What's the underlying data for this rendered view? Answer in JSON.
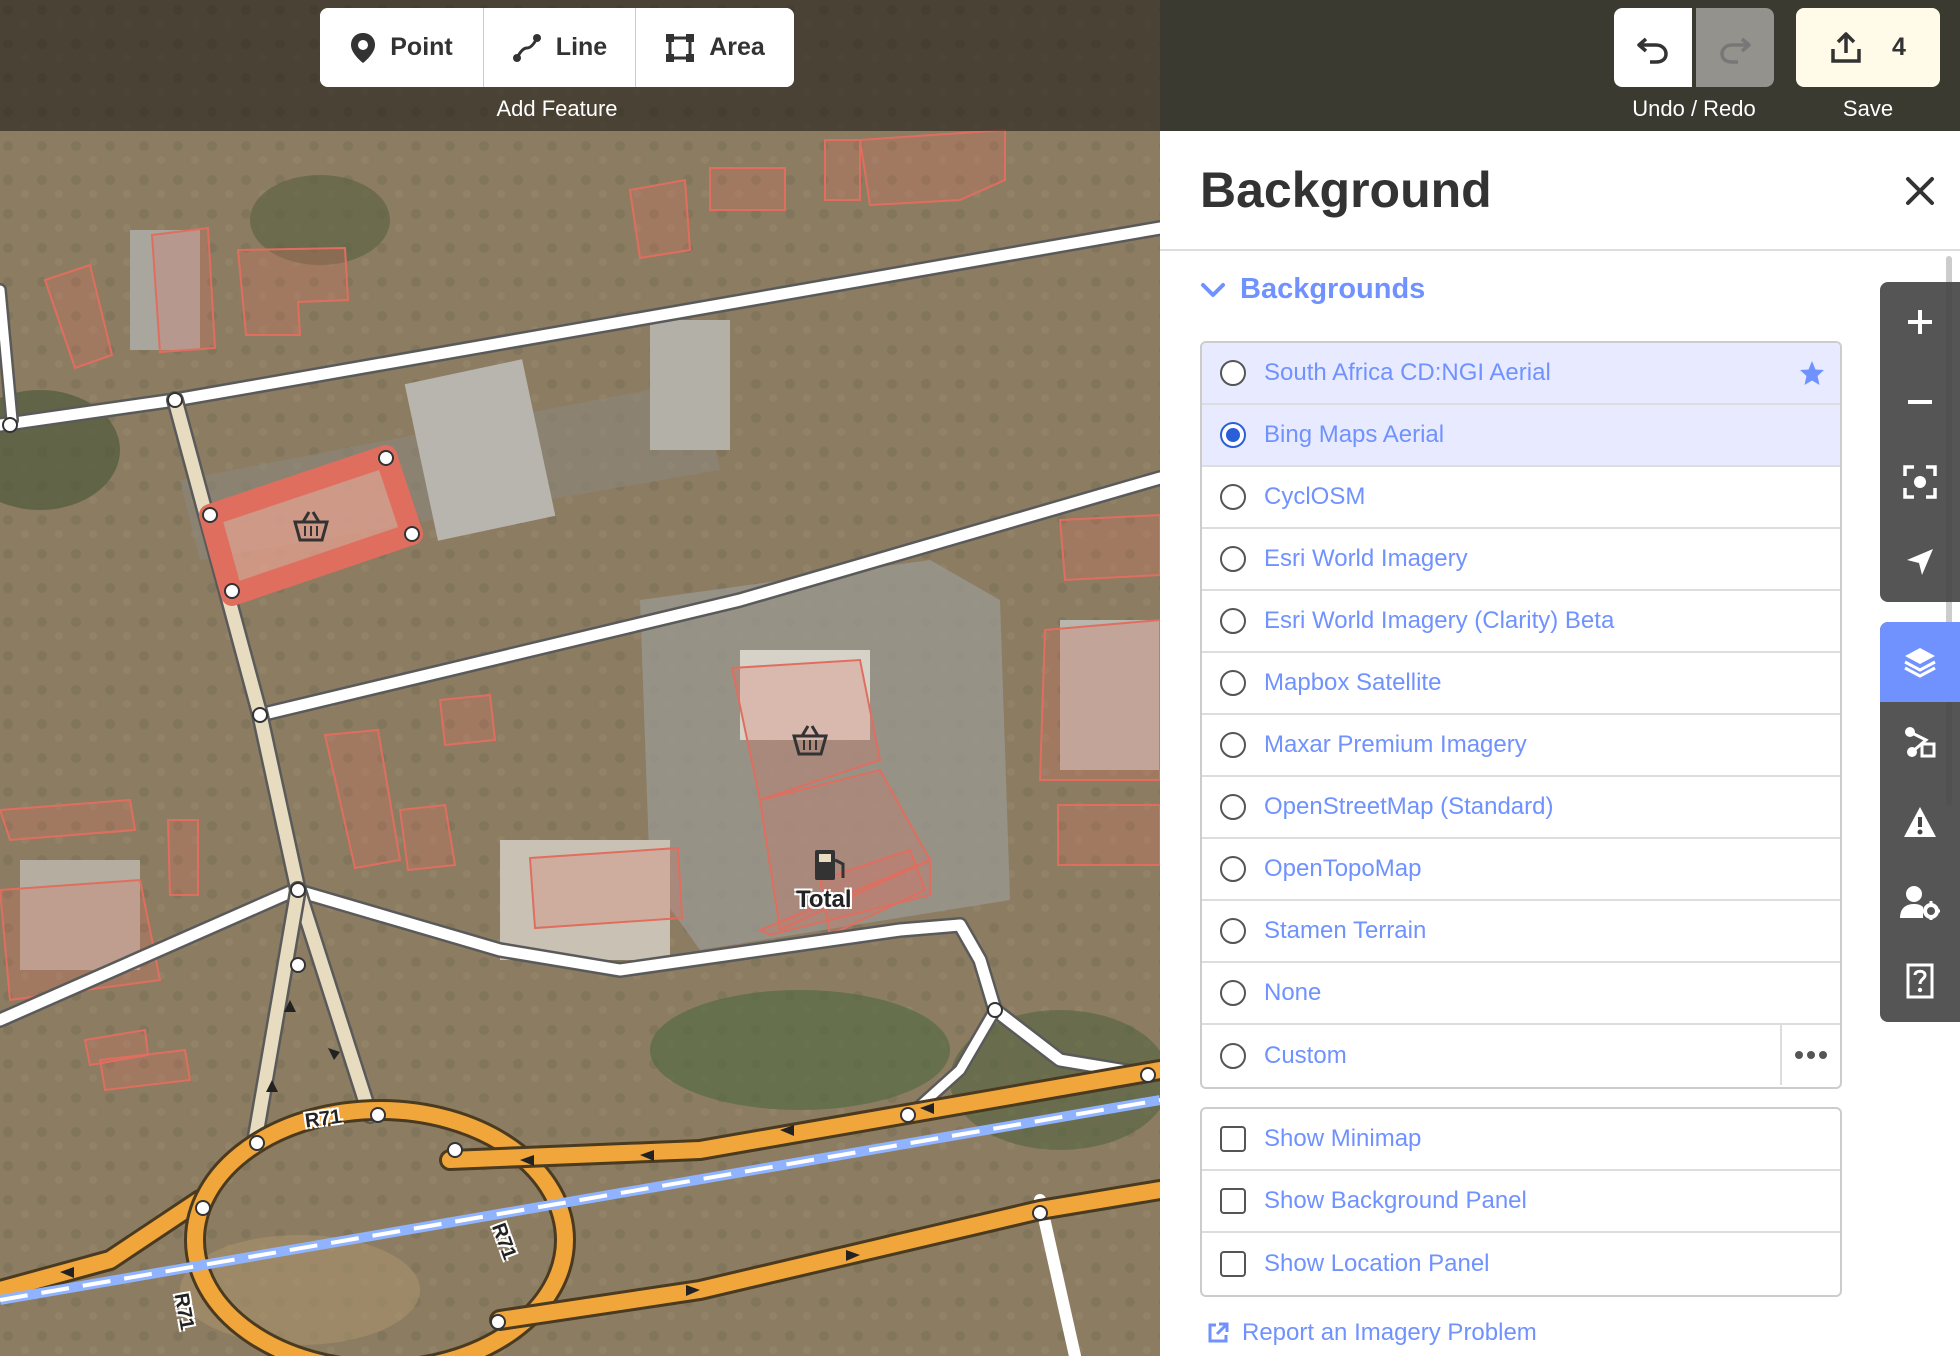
{
  "toolbar": {
    "add_feature": {
      "caption": "Add Feature",
      "buttons": [
        {
          "label": "Point",
          "icon": "marker-icon"
        },
        {
          "label": "Line",
          "icon": "line-icon"
        },
        {
          "label": "Area",
          "icon": "area-icon"
        }
      ]
    },
    "undo_redo": {
      "caption": "Undo / Redo"
    },
    "save": {
      "caption": "Save",
      "count": "4",
      "icon": "upload-icon"
    }
  },
  "map": {
    "poi_label": "Total",
    "road_labels": [
      "R71",
      "R71",
      "R71"
    ]
  },
  "panel": {
    "title": "Background",
    "section_title": "Backgrounds",
    "backgrounds": [
      {
        "label": "South Africa CD:NGI Aerial",
        "selected": false,
        "best": true
      },
      {
        "label": "Bing Maps Aerial",
        "selected": true
      },
      {
        "label": "CyclOSM",
        "selected": false
      },
      {
        "label": "Esri World Imagery",
        "selected": false
      },
      {
        "label": "Esri World Imagery (Clarity) Beta",
        "selected": false
      },
      {
        "label": "Mapbox Satellite",
        "selected": false
      },
      {
        "label": "Maxar Premium Imagery",
        "selected": false
      },
      {
        "label": "OpenStreetMap (Standard)",
        "selected": false
      },
      {
        "label": "OpenTopoMap",
        "selected": false
      },
      {
        "label": "Stamen Terrain",
        "selected": false
      },
      {
        "label": "None",
        "selected": false
      },
      {
        "label": "Custom",
        "selected": false
      }
    ],
    "options": [
      {
        "label": "Show Minimap",
        "checked": false
      },
      {
        "label": "Show Background Panel",
        "checked": false
      },
      {
        "label": "Show Location Panel",
        "checked": false
      }
    ],
    "report_link": "Report an Imagery Problem"
  },
  "controls": {
    "map": [
      "zoom-in-icon",
      "zoom-out-icon",
      "zoom-to-selection-icon",
      "geolocate-icon"
    ],
    "panes": [
      "background-layers-icon",
      "map-data-icon",
      "issues-icon",
      "preferences-icon",
      "help-icon"
    ]
  },
  "colors": {
    "accent": "#7092ff",
    "primary_road": "#f0a63a",
    "building_outline": "#e06e5f",
    "selected_area": "#e06e5f"
  }
}
